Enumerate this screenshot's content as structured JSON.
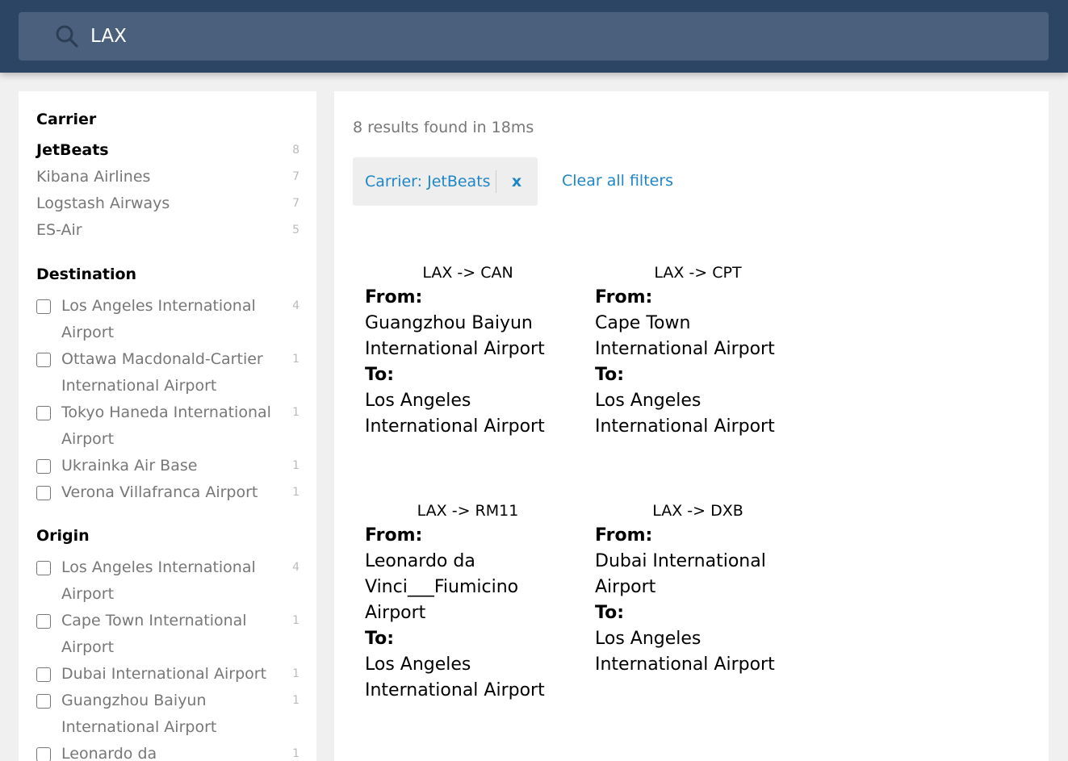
{
  "search": {
    "value": "LAX"
  },
  "facets": {
    "carrier": {
      "title": "Carrier",
      "items": [
        {
          "label": "JetBeats",
          "count": "8",
          "selected": true
        },
        {
          "label": "Kibana Airlines",
          "count": "7"
        },
        {
          "label": "Logstash Airways",
          "count": "7"
        },
        {
          "label": "ES-Air",
          "count": "5"
        }
      ]
    },
    "destination": {
      "title": "Destination",
      "items": [
        {
          "label": "Los Angeles International Airport",
          "count": "4"
        },
        {
          "label": "Ottawa Macdonald-Cartier International Airport",
          "count": "1"
        },
        {
          "label": "Tokyo Haneda International Airport",
          "count": "1"
        },
        {
          "label": "Ukrainka Air Base",
          "count": "1"
        },
        {
          "label": "Verona Villafranca Airport",
          "count": "1"
        }
      ]
    },
    "origin": {
      "title": "Origin",
      "items": [
        {
          "label": "Los Angeles International Airport",
          "count": "4"
        },
        {
          "label": "Cape Town International Airport",
          "count": "1"
        },
        {
          "label": "Dubai International Airport",
          "count": "1"
        },
        {
          "label": "Guangzhou Baiyun International Airport",
          "count": "1"
        },
        {
          "label": "Leonardo da Vinci___Fiumicino Airport",
          "count": "1"
        }
      ]
    }
  },
  "results": {
    "summary": "8 results found in 18ms",
    "active_filter": "Carrier: JetBeats",
    "remove_filter": "x",
    "clear_all": "Clear all filters",
    "from_label": "From:",
    "to_label": "To:",
    "cards": [
      {
        "title": "LAX -> CAN",
        "from": "Guangzhou Baiyun International Airport",
        "to": "Los Angeles International Airport"
      },
      {
        "title": "LAX -> CPT",
        "from": "Cape Town International Airport",
        "to": "Los Angeles International Airport"
      },
      {
        "title": "LAX -> RM11",
        "from": "Leonardo da Vinci___Fiumicino Airport",
        "to": "Los Angeles International Airport"
      },
      {
        "title": "LAX -> DXB",
        "from": "Dubai International Airport",
        "to": "Los Angeles International Airport"
      }
    ]
  },
  "colors": {
    "topbar": "#2c4564",
    "searchbox": "#4b607d",
    "link": "#1f86c7"
  }
}
